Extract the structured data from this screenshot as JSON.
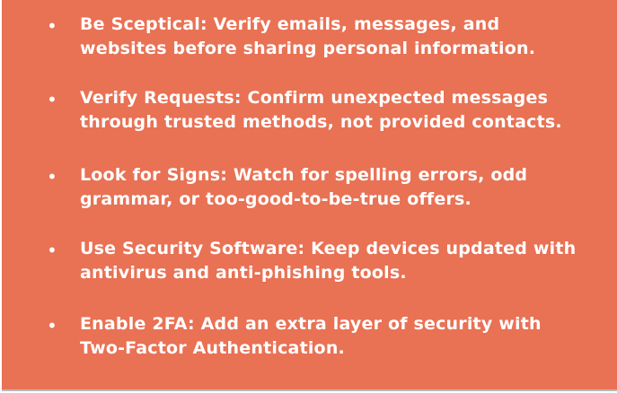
{
  "tips": [
    {
      "bullet": "•",
      "line1": "Be Sceptical: Verify emails, messages, and",
      "line2": "websites before sharing personal information."
    },
    {
      "bullet": "•",
      "line1": "Verify Requests: Confirm unexpected messages",
      "line2": "through trusted methods, not provided contacts."
    },
    {
      "bullet": "•",
      "line1": "Look for Signs: Watch for spelling errors, odd",
      "line2": "grammar, or too-good-to-be-true offers."
    },
    {
      "bullet": "•",
      "line1": "Use Security Software: Keep devices updated with",
      "line2": "antivirus and anti-phishing tools."
    },
    {
      "bullet": "•",
      "line1": "Enable 2FA: Add an extra layer of security with",
      "line2": "Two-Factor Authentication."
    }
  ],
  "colors": {
    "background": "#e97154",
    "text": "#ffffff"
  }
}
